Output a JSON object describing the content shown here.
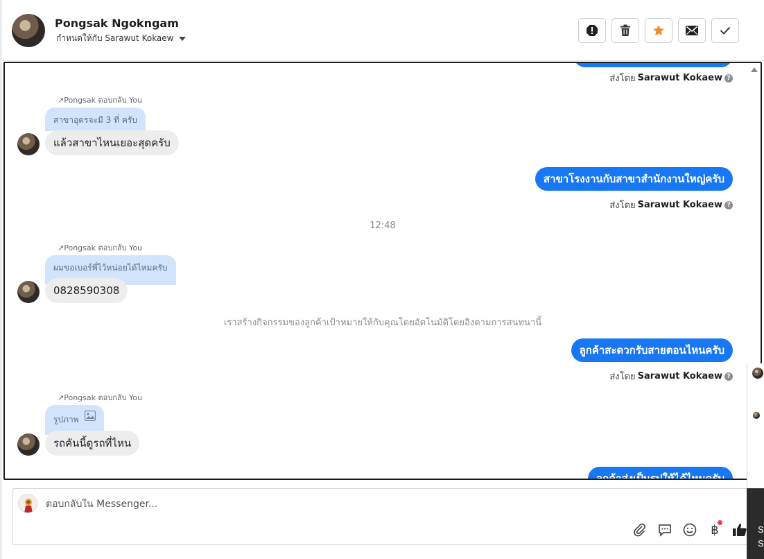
{
  "header": {
    "name": "Pongsak Ngokngam",
    "assigned": "กำหนดให้กับ Sarawut Kokaew",
    "actions": [
      "spam-icon",
      "trash-icon",
      "star-icon",
      "mail-icon",
      "check-icon"
    ],
    "star_color": "#f08c28"
  },
  "chat": {
    "top_sent_by_prefix": "ส่งโดย",
    "top_sent_by_name": "Sarawut Kokaew",
    "msg1": {
      "reply_header": "Pongsak ตอบกลับ You",
      "quote": "สาขาอุดรจะมี 3 ที่ ครับ",
      "text": "แล้วสาขาไหนเยอะสุดครับ"
    },
    "out1": {
      "text": "สาขาโรงงานกับสาขาสำนักงานใหญ่ครับ",
      "sent_by_prefix": "ส่งโดย",
      "sent_by_name": "Sarawut Kokaew"
    },
    "timestamp": "12:48",
    "msg2": {
      "reply_header": "Pongsak ตอบกลับ You",
      "quote": "ผมขอเบอร์พี่ไว้หน่อยได้ไหมครับ",
      "text": "0828590308"
    },
    "system_note": "เราสร้างกิจกรรมของลูกค้าเป้าหมายให้กับคุณโดยอัตโนมัติโดยอิงตามการสนทนานี้",
    "out2": {
      "text": "ลูกค้าสะดวกรับสายตอนไหนครับ",
      "sent_by_prefix": "ส่งโดย",
      "sent_by_name": "Sarawut Kokaew"
    },
    "msg3": {
      "reply_header": "Pongsak ตอบกลับ You",
      "quote": "รูปภาพ",
      "text": "รถคันนี้ดูรถที่ไหน"
    },
    "out3_partial": "ลูกค้าส่งเป็นรูปให้ได้ไหมครับ",
    "accent": "#1877f2"
  },
  "composer": {
    "placeholder": "ตอบกลับใน Messenger...",
    "tools": [
      "paperclip-icon",
      "saved-reply-icon",
      "emoji-icon",
      "baht-icon",
      "thumbs-up-icon"
    ]
  },
  "edge": {
    "text1": "S",
    "text2": "S"
  }
}
